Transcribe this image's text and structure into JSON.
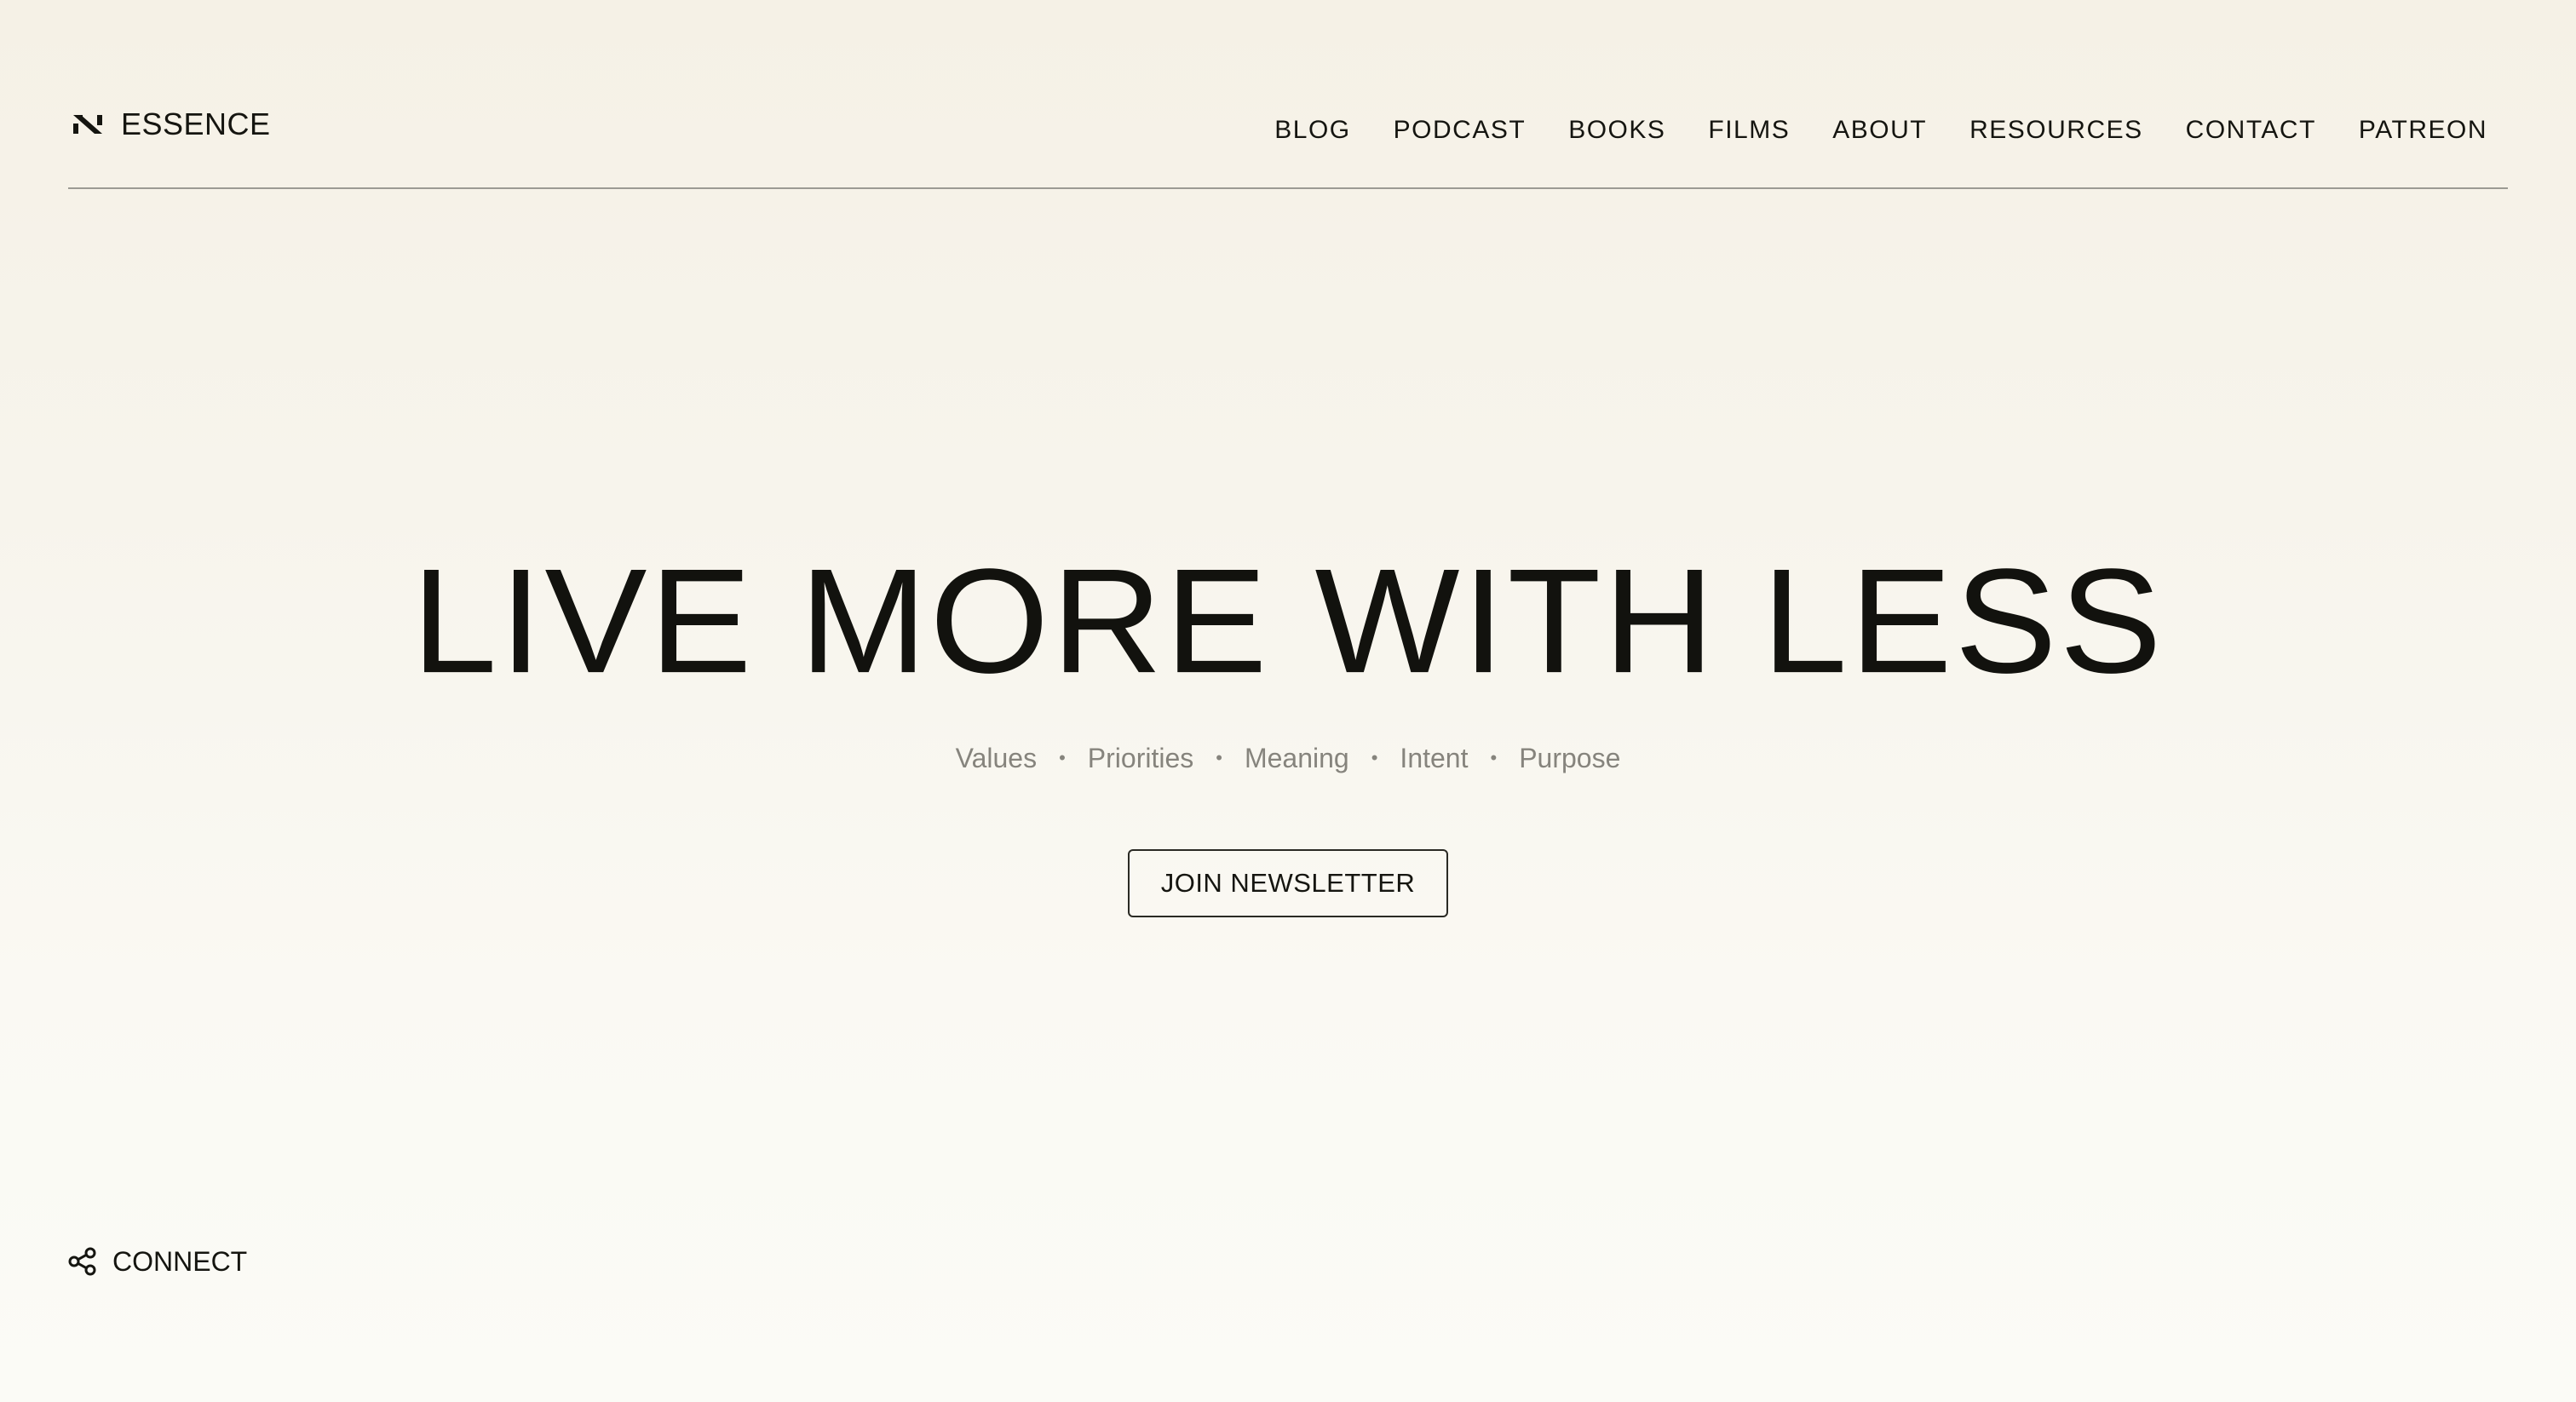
{
  "brand": {
    "name": "ESSENCE",
    "icon": "essence-logo-icon"
  },
  "nav": {
    "items": [
      {
        "label": "BLOG"
      },
      {
        "label": "PODCAST"
      },
      {
        "label": "BOOKS"
      },
      {
        "label": "FILMS"
      },
      {
        "label": "ABOUT"
      },
      {
        "label": "RESOURCES"
      },
      {
        "label": "CONTACT"
      },
      {
        "label": "PATREON"
      }
    ]
  },
  "hero": {
    "title": "LIVE MORE WITH LESS",
    "tags": [
      "Values",
      "Priorities",
      "Meaning",
      "Intent",
      "Purpose"
    ],
    "separator": "•",
    "cta_label": "JOIN NEWSLETTER"
  },
  "connect": {
    "label": "CONNECT",
    "icon": "share-icon"
  },
  "colors": {
    "background": "#f7f4ec",
    "text": "#151510",
    "muted": "#86847d",
    "divider": "#9c9a93"
  }
}
